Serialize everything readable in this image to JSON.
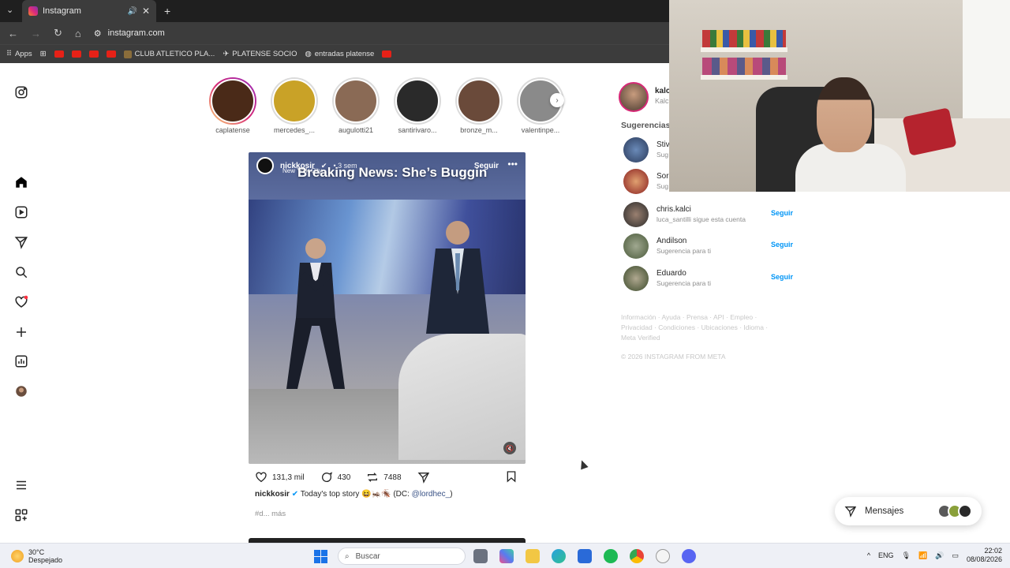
{
  "browser": {
    "tab_title": "Instagram",
    "url": "instagram.com",
    "bookmarks": [
      "Apps",
      "CLUB ATLETICO PLA...",
      "PLATENSE SOCIO",
      "entradas platense"
    ]
  },
  "stories": [
    {
      "name": "caplatense",
      "active": true,
      "color": "#4a2a18"
    },
    {
      "name": "mercedes_...",
      "active": false,
      "color": "#c9a227"
    },
    {
      "name": "augulotti21",
      "active": false,
      "color": "#8a6a55"
    },
    {
      "name": "santirivaro...",
      "active": false,
      "color": "#2a2a2a"
    },
    {
      "name": "bronze_m...",
      "active": false,
      "color": "#6a4a3a"
    },
    {
      "name": "valentinpe...",
      "active": false,
      "color": "#8a8a8a"
    }
  ],
  "post": {
    "user": "nickkosir",
    "ago": "• 3 sem",
    "location": "New York City",
    "follow": "Seguir",
    "overlay_title": "Breaking News: She’s Buggin",
    "likes": "131,3 mil",
    "comments": "430",
    "reposts": "7488",
    "caption_user": "nickkosir",
    "caption_text": "Today's top story 😆🦗🪳 (DC: ",
    "caption_mention": "@lordhec_",
    "caption_end": ")",
    "hashtags": "#d... más"
  },
  "sidebar": {
    "me_name": "kalc",
    "me_sub": "Kalc",
    "suggestions_title": "Sugerencias",
    "suggestions": [
      {
        "name": "Stiv",
        "sub": "Sug",
        "button": "",
        "color": "#3a5a8a"
      },
      {
        "name": "Sor",
        "sub": "Sug",
        "button": "",
        "color": "#a82a2a"
      },
      {
        "name": "chris.kalci",
        "sub": "luca_santilli sigue esta cuenta",
        "button": "Seguir",
        "color": "#3a3a3a"
      },
      {
        "name": "Andilson",
        "sub": "Sugerencia para ti",
        "button": "Seguir",
        "color": "#6a7a5a"
      },
      {
        "name": "Eduardo",
        "sub": "Sugerencia para ti",
        "button": "Seguir",
        "color": "#5a6a4a"
      }
    ],
    "footer_links": "Información · Ayuda · Prensa · API · Empleo · Privacidad · Condiciones · Ubicaciones · Idioma · Meta Verified",
    "copyright": "© 2026 INSTAGRAM FROM META"
  },
  "messages": {
    "label": "Mensajes"
  },
  "taskbar": {
    "temp": "30°C",
    "weather": "Despejado",
    "search_placeholder": "Buscar",
    "lang": "ENG",
    "time": "22:02",
    "date": "08/08/2026"
  }
}
